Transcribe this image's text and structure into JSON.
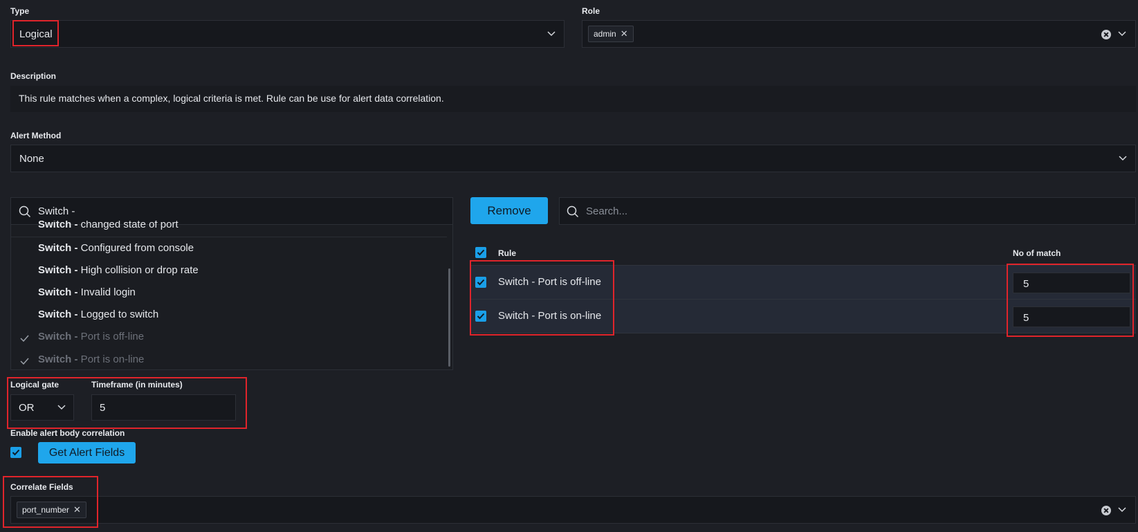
{
  "type": {
    "label": "Type",
    "value": "Logical"
  },
  "role": {
    "label": "Role",
    "chips": [
      "admin"
    ]
  },
  "description": {
    "label": "Description",
    "text": "This rule matches when a complex, logical criteria is met. Rule can be use for alert data correlation."
  },
  "alert_method": {
    "label": "Alert Method",
    "value": "None"
  },
  "rule_search": {
    "query": "Switch -",
    "items": [
      {
        "bold": "Switch -",
        "rest": " changed state of port",
        "selected": false
      },
      {
        "bold": "Switch -",
        "rest": " Configured from console",
        "selected": false
      },
      {
        "bold": "Switch -",
        "rest": " High collision or drop rate",
        "selected": false
      },
      {
        "bold": "Switch -",
        "rest": " Invalid login",
        "selected": false
      },
      {
        "bold": "Switch -",
        "rest": " Logged to switch",
        "selected": false
      },
      {
        "bold": "Switch -",
        "rest": " Port is off-line",
        "selected": true
      },
      {
        "bold": "Switch -",
        "rest": " Port is on-line",
        "selected": true
      }
    ]
  },
  "remove_button": "Remove",
  "table_search": {
    "placeholder": "Search..."
  },
  "table": {
    "col_rule": "Rule",
    "col_match": "No of match",
    "rows": [
      {
        "rule": "Switch - Port is off-line",
        "match": "5"
      },
      {
        "rule": "Switch - Port is on-line",
        "match": "5"
      }
    ]
  },
  "logical_gate": {
    "label": "Logical gate",
    "value": "OR"
  },
  "timeframe": {
    "label": "Timeframe (in minutes)",
    "value": "5"
  },
  "enable_correlation": {
    "label": "Enable alert body correlation",
    "button": "Get Alert Fields"
  },
  "correlate_fields": {
    "label": "Correlate Fields",
    "chips": [
      "port_number"
    ]
  },
  "colors": {
    "accent": "#1fa6ec",
    "highlight": "#e0242b",
    "background": "#1d1f25"
  }
}
